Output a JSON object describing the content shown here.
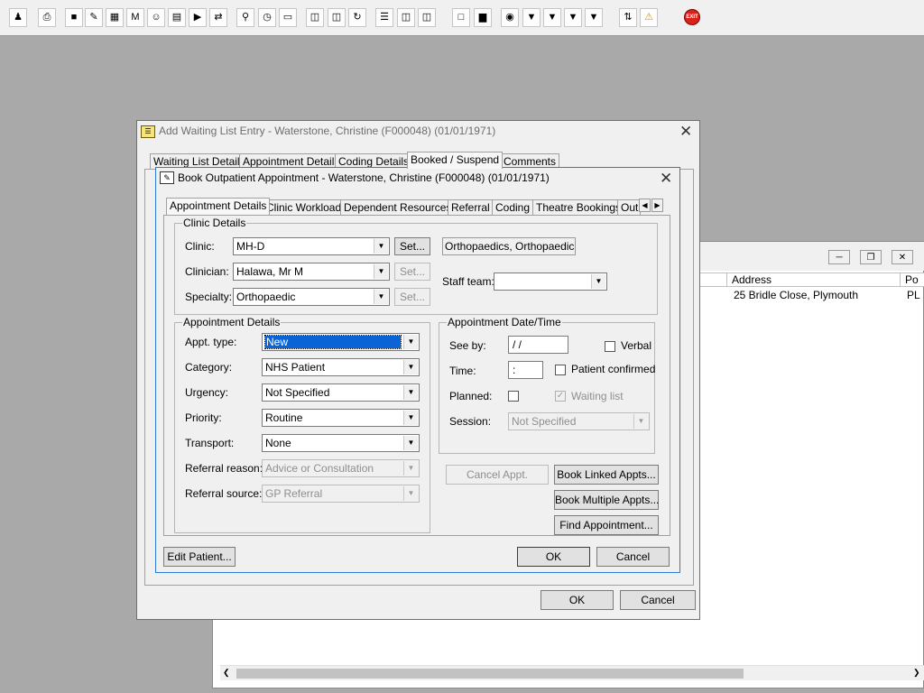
{
  "toolbar": {
    "icons": [
      "patient-search-icon",
      "printer-icon",
      "book-icon",
      "edit-icon",
      "calendar-icon",
      "letter-m-icon",
      "person-icon",
      "notepad-icon",
      "referral-icon",
      "transfer-icon",
      "search-icon",
      "clock-icon",
      "monitor-icon",
      "report-icon",
      "chart-icon",
      "cycle-icon",
      "list-icon",
      "tray-icon",
      "network-icon",
      "document-icon",
      "bar-chart-icon",
      "globe-icon",
      "inbox-icon",
      "outbox-icon",
      "export-icon",
      "swap-icon",
      "warning-icon",
      "exit-icon"
    ],
    "exit_label": "EXIT"
  },
  "background_window": {
    "columns": {
      "address": "Address",
      "postcode": "Po"
    },
    "row": {
      "address": "25 Bridle Close, Plymouth",
      "postcode": "PL"
    }
  },
  "waiting_list_dialog": {
    "title": "Add Waiting List Entry - Waterstone, Christine (F000048) (01/01/1971)",
    "tabs": [
      "Waiting List Details",
      "Appointment Details",
      "Coding Details",
      "Booked / Suspend",
      "Comments"
    ],
    "ok_label": "OK",
    "cancel_label": "Cancel"
  },
  "book_dialog": {
    "title": "Book Outpatient Appointment - Waterstone, Christine (F000048) (01/01/1971)",
    "tabs": [
      "Appointment Details",
      "Clinic Workload",
      "Dependent Resources",
      "Referral",
      "Coding",
      "Theatre Bookings",
      "Out"
    ],
    "clinic_details": {
      "legend": "Clinic Details",
      "clinic_label": "Clinic:",
      "clinic_value": "MH-D",
      "clinic_desc": "Orthopaedics, Orthopaedic OF",
      "clinician_label": "Clinician:",
      "clinician_value": "Halawa, Mr M",
      "specialty_label": "Specialty:",
      "specialty_value": "Orthopaedic",
      "set_label": "Set...",
      "staff_team_label": "Staff team:",
      "staff_team_value": ""
    },
    "appointment_details": {
      "legend": "Appointment Details",
      "appt_type_label": "Appt. type:",
      "appt_type_value": "New",
      "category_label": "Category:",
      "category_value": "NHS Patient",
      "urgency_label": "Urgency:",
      "urgency_value": "Not Specified",
      "priority_label": "Priority:",
      "priority_value": "Routine",
      "transport_label": "Transport:",
      "transport_value": "None",
      "referral_reason_label": "Referral reason:",
      "referral_reason_value": "Advice or Consultation",
      "referral_source_label": "Referral source:",
      "referral_source_value": "GP Referral"
    },
    "date_time": {
      "legend": "Appointment Date/Time",
      "see_by_label": "See by:",
      "see_by_value": " /  /",
      "verbal_label": "Verbal",
      "time_label": "Time:",
      "time_value": " :",
      "patient_confirmed_label": "Patient confirmed",
      "planned_label": "Planned:",
      "waiting_list_label": "Waiting list",
      "session_label": "Session:",
      "session_value": "Not Specified"
    },
    "buttons": {
      "cancel_appt": "Cancel Appt.",
      "book_linked": "Book Linked Appts...",
      "book_multiple": "Book Multiple Appts...",
      "find_appointment": "Find Appointment...",
      "edit_patient": "Edit Patient...",
      "ok": "OK",
      "cancel": "Cancel"
    }
  }
}
